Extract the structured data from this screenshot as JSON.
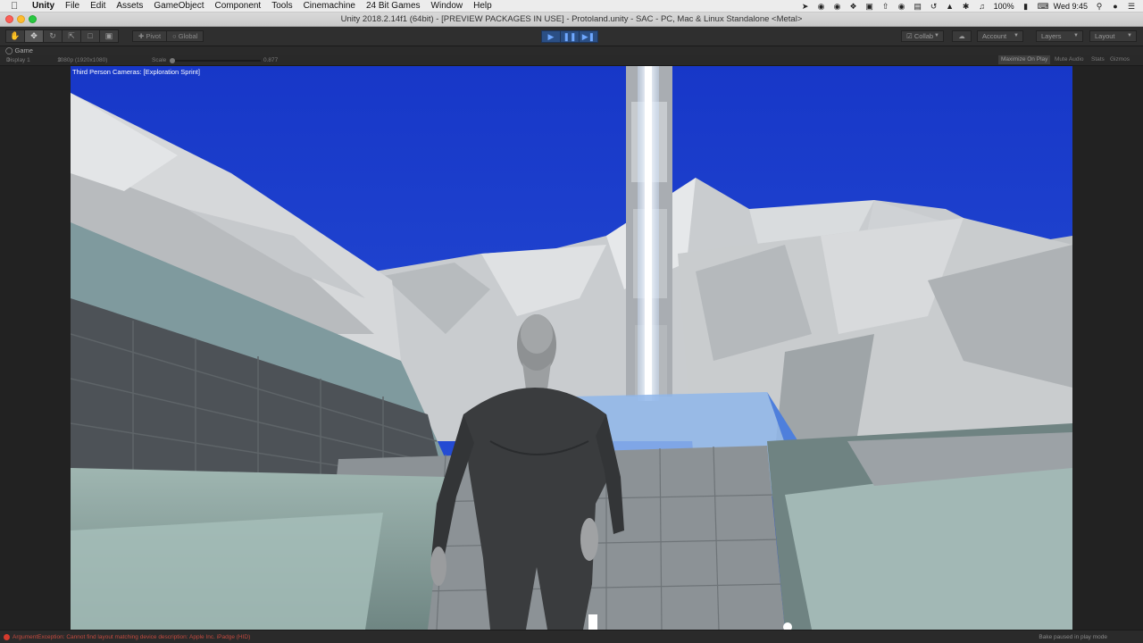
{
  "menubar": {
    "apple": "",
    "items": [
      "Unity",
      "File",
      "Edit",
      "Assets",
      "GameObject",
      "Component",
      "Tools",
      "Cinemachine",
      "24 Bit Games",
      "Window",
      "Help"
    ],
    "battery": "100%",
    "clock": "Wed 9:45"
  },
  "window": {
    "title": "Unity 2018.2.14f1 (64bit) - [PREVIEW PACKAGES IN USE] - Protoland.unity - SAC - PC, Mac & Linux Standalone <Metal>"
  },
  "toolbar": {
    "pivot_label": "Pivot",
    "global_label": "Global",
    "collab_label": "Collab",
    "account_label": "Account",
    "layers_label": "Layers",
    "layout_label": "Layout"
  },
  "game_view": {
    "tab_label": "Game",
    "display_label": "Display 1",
    "resolution_label": "1080p (1920x1080)",
    "scale_label": "Scale",
    "scale_value": "0.877",
    "maximize_label": "Maximize On Play",
    "mute_label": "Mute Audio",
    "stats_label": "Stats",
    "gizmos_label": "Gizmos",
    "camera_label": "Third Person Cameras: [Exploration Sprint]"
  },
  "status": {
    "error_text": "ArgumentException: Cannot find layout matching device description: Apple Inc. iPadge (HID)",
    "bake_text": "Bake paused in play mode"
  },
  "colors": {
    "sky": "#1d3fd0",
    "play_blue": "#2b4f85",
    "error_red": "#d63a2d"
  }
}
